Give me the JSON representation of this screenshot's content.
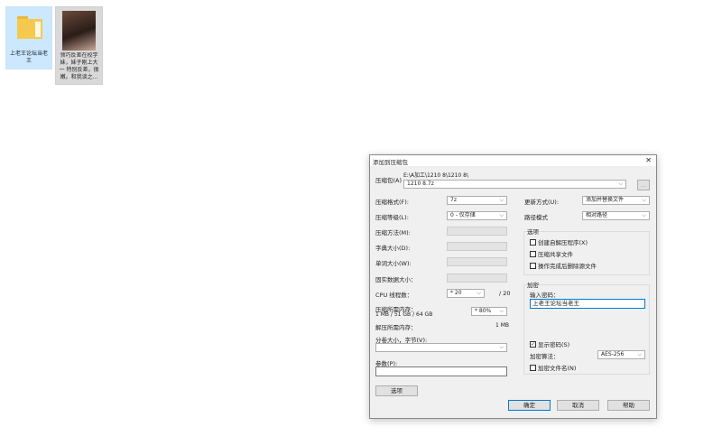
{
  "desktop": {
    "items": [
      {
        "label": "上老王论坛当老王",
        "type": "folder"
      },
      {
        "label": "领巧反差在校学妹，妹子刚上大一 特别反差，很嫩。和我谈之...",
        "type": "image"
      }
    ]
  },
  "dialog": {
    "title": "添加到压缩包",
    "archive_label": "压缩包(A)",
    "archive_path": "E:\\A加工\\1210 8\\1210 8\\",
    "archive_name": "1210 8.7z",
    "browse_label": "...",
    "format_label": "压缩格式(F):",
    "format_value": "7z",
    "level_label": "压缩等级(L):",
    "level_value": "0 - 仅存储",
    "method_label": "压缩方法(M):",
    "dict_label": "字典大小(D):",
    "word_label": "单词大小(W):",
    "solid_label": "固实数据大小：",
    "cpu_label": "CPU 线程数：",
    "cpu_value": "* 20",
    "cpu_max": "/ 20",
    "mem_label": "压缩所需内存：",
    "mem_detail": "1 MB / 51 GB / 64 GB",
    "mem_value": "* 80%",
    "decomp_label": "解压所需内存：",
    "decomp_value": "1 MB",
    "split_label": "分卷大小，字节(V):",
    "params_label": "参数(P):",
    "options_button": "选项",
    "update_label": "更新方式(U):",
    "update_value": "添加并替换文件",
    "path_label": "路径模式",
    "path_value": "相对路径",
    "options_group": "选项",
    "opt_sfx": "创建自解压程序(X)",
    "opt_shared": "压缩共享文件",
    "opt_delete": "操作完成后删除源文件",
    "enc_group": "加密",
    "pwd_label": "输入密码：",
    "pwd_value": "上老王论坛当老王",
    "show_pwd": "显示密码(S)",
    "enc_method_label": "加密算法：",
    "enc_method_value": "AES-256",
    "enc_names": "加密文件名(N)",
    "ok": "确定",
    "cancel": "取消",
    "help": "帮助",
    "close": "✕",
    "check": "✓"
  }
}
